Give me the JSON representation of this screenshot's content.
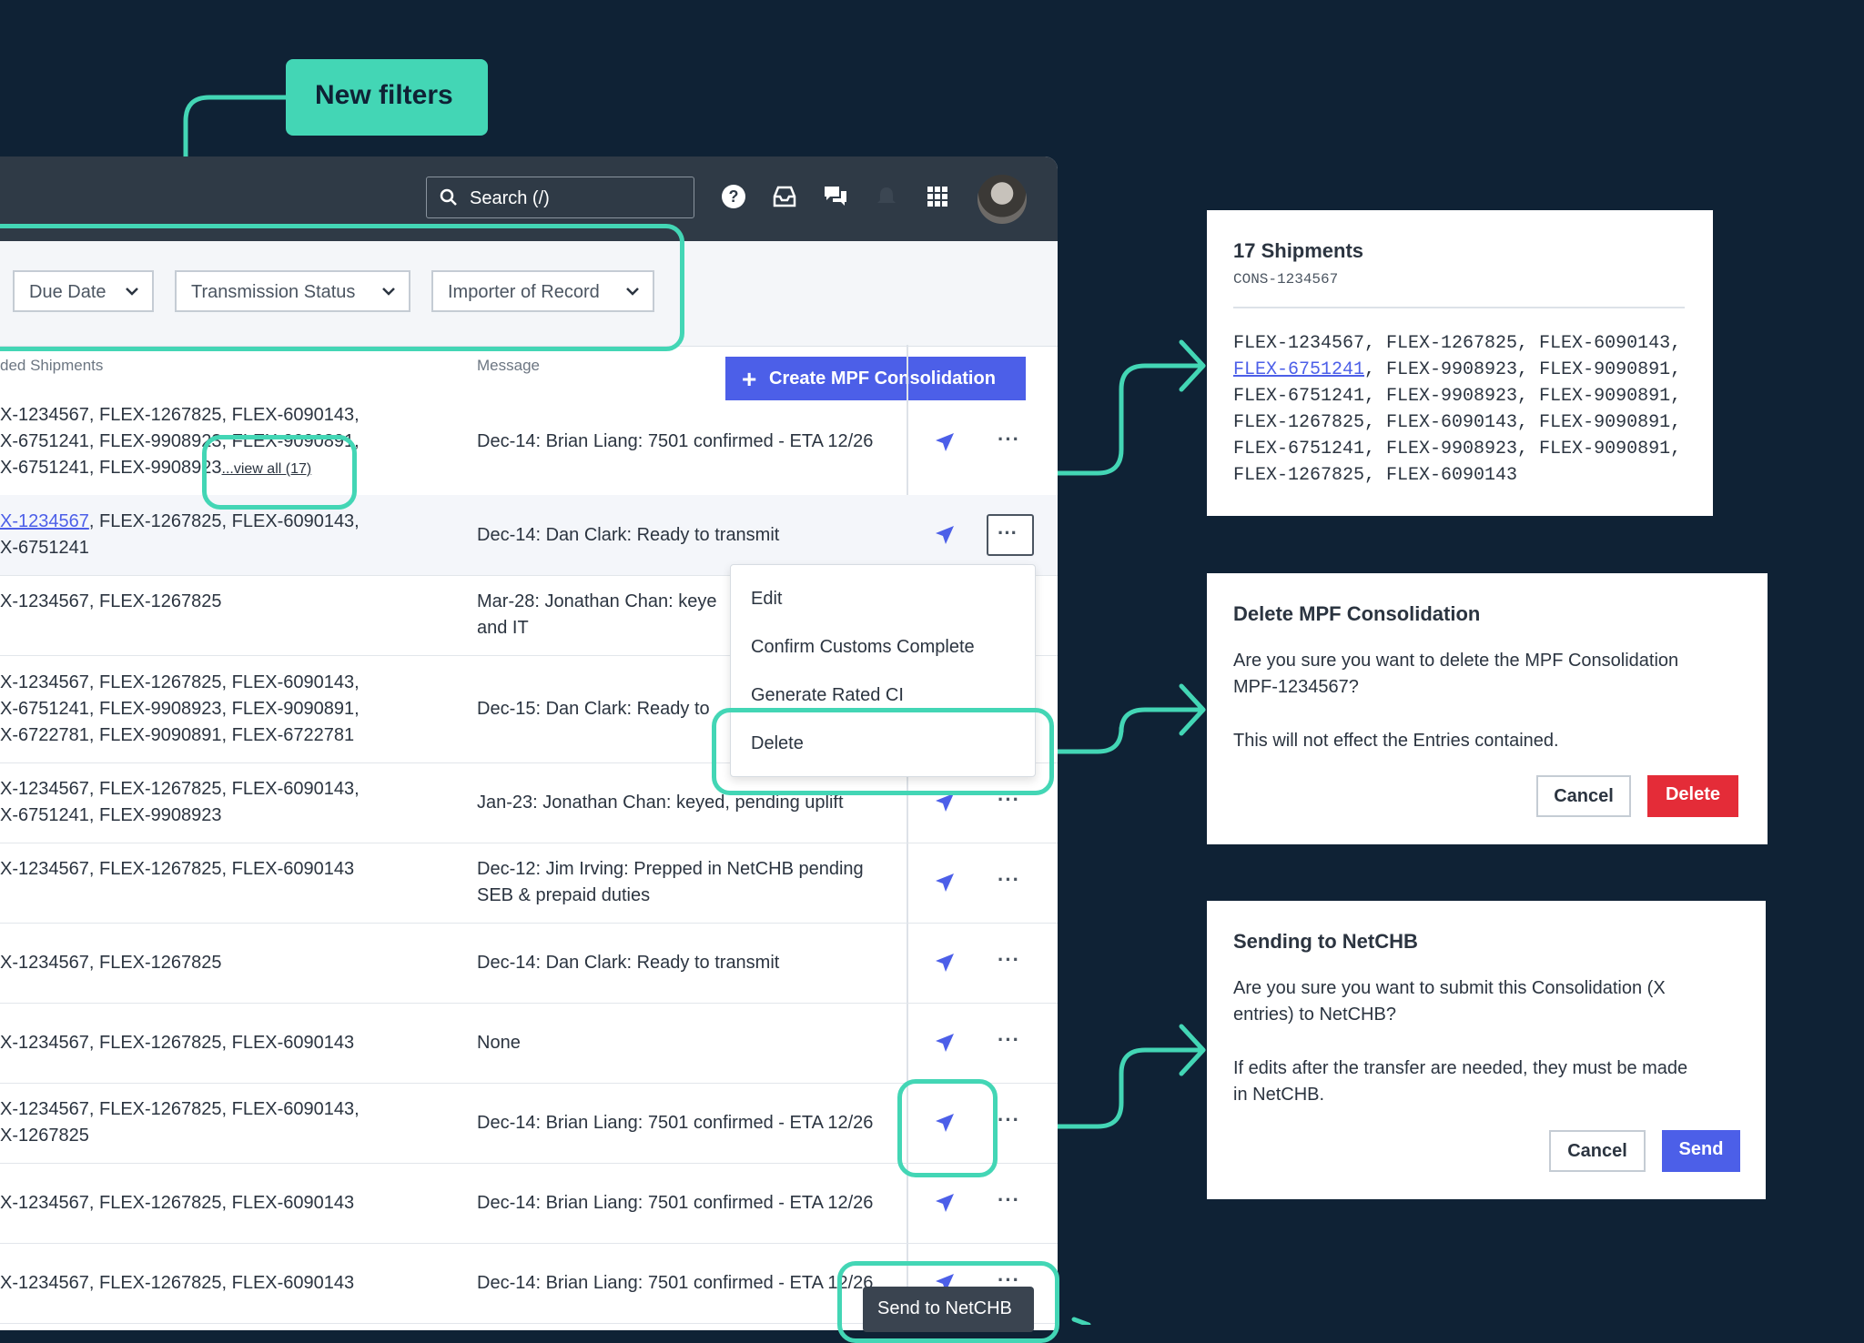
{
  "callout": {
    "label": "New filters"
  },
  "topbar": {
    "search_placeholder": "Search (/)",
    "icons": [
      "search-icon",
      "help-icon",
      "inbox-icon",
      "chat-icon",
      "bell-icon",
      "apps-grid-icon"
    ]
  },
  "filters": {
    "due_date": "Due Date",
    "transmission_status": "Transmission Status",
    "importer_of_record": "Importer of Record",
    "create_button": "Create MPF Consolidation"
  },
  "table": {
    "col_shipments": "ded Shipments",
    "col_message": "Message",
    "view_all": "...view all (17)",
    "rows": [
      {
        "ship": "X-1234567, FLEX-1267825, FLEX-6090143,\nX-6751241, FLEX-9908923, FLEX-9090891,\nX-6751241, FLEX-9908923",
        "msg": "Dec-14: Brian Liang: 7501 confirmed - ETA 12/26"
      },
      {
        "ship_link": "X-1234567",
        "ship_rest": ", FLEX-1267825, FLEX-6090143,\nX-6751241",
        "msg": "Dec-14: Dan Clark: Ready to transmit"
      },
      {
        "ship": "X-1234567, FLEX-1267825",
        "msg": "Mar-28: Jonathan Chan: keye\nand IT"
      },
      {
        "ship": "X-1234567, FLEX-1267825, FLEX-6090143,\nX-6751241, FLEX-9908923, FLEX-9090891,\nX-6722781, FLEX-9090891, FLEX-6722781",
        "msg": "Dec-15: Dan Clark: Ready to"
      },
      {
        "ship": "X-1234567, FLEX-1267825, FLEX-6090143,\nX-6751241, FLEX-9908923",
        "msg": "Jan-23: Jonathan Chan: keyed, pending uplift"
      },
      {
        "ship": "X-1234567, FLEX-1267825, FLEX-6090143",
        "msg": "Dec-12: Jim Irving: Prepped in NetCHB pending\nSEB & prepaid duties"
      },
      {
        "ship": "X-1234567, FLEX-1267825",
        "msg": "Dec-14: Dan Clark: Ready to transmit"
      },
      {
        "ship": "X-1234567, FLEX-1267825, FLEX-6090143",
        "msg": "None"
      },
      {
        "ship": "X-1234567, FLEX-1267825, FLEX-6090143,\nX-1267825",
        "msg": "Dec-14: Brian Liang: 7501 confirmed - ETA 12/26"
      },
      {
        "ship": "X-1234567, FLEX-1267825, FLEX-6090143",
        "msg": "Dec-14: Brian Liang: 7501 confirmed - ETA 12/26"
      },
      {
        "ship": "X-1234567, FLEX-1267825, FLEX-6090143",
        "msg": "Dec-14: Brian Liang: 7501 confirmed - ETA 12/26"
      }
    ],
    "more_label": "···"
  },
  "menu": {
    "items": [
      "Edit",
      "Confirm Customs Complete",
      "Generate Rated CI",
      "Delete"
    ]
  },
  "tooltip": "Send to NetCHB",
  "shipments_card": {
    "title": "17 Shipments",
    "subtitle": "CONS-1234567",
    "line1": "FLEX-1234567, FLEX-1267825, FLEX-6090143,",
    "line2_link": "FLEX-6751241",
    "line2_rest": ", FLEX-9908923, FLEX-9090891,",
    "lines": "FLEX-6751241, FLEX-9908923, FLEX-9090891,\nFLEX-1267825, FLEX-6090143, FLEX-9090891,\nFLEX-6751241, FLEX-9908923, FLEX-9090891,\nFLEX-1267825, FLEX-6090143"
  },
  "delete_card": {
    "title": "Delete MPF Consolidation",
    "body": "Are you sure you want to delete the MPF Consolidation\nMPF-1234567?",
    "note": "This will not effect the Entries contained.",
    "cancel": "Cancel",
    "confirm": "Delete",
    "confirm_color": "#e42c38"
  },
  "send_card": {
    "title": "Sending to NetCHB",
    "body": "Are you sure you want to submit this Consolidation (X\nentries) to NetCHB?",
    "note": "If edits after the transfer are needed, they must be made\nin NetCHB.",
    "cancel": "Cancel",
    "confirm": "Send",
    "confirm_color": "#4c5fe8"
  },
  "colors": {
    "background": "#0f2235",
    "callout": "#43d6b5",
    "accent": "#4c5fe8"
  }
}
